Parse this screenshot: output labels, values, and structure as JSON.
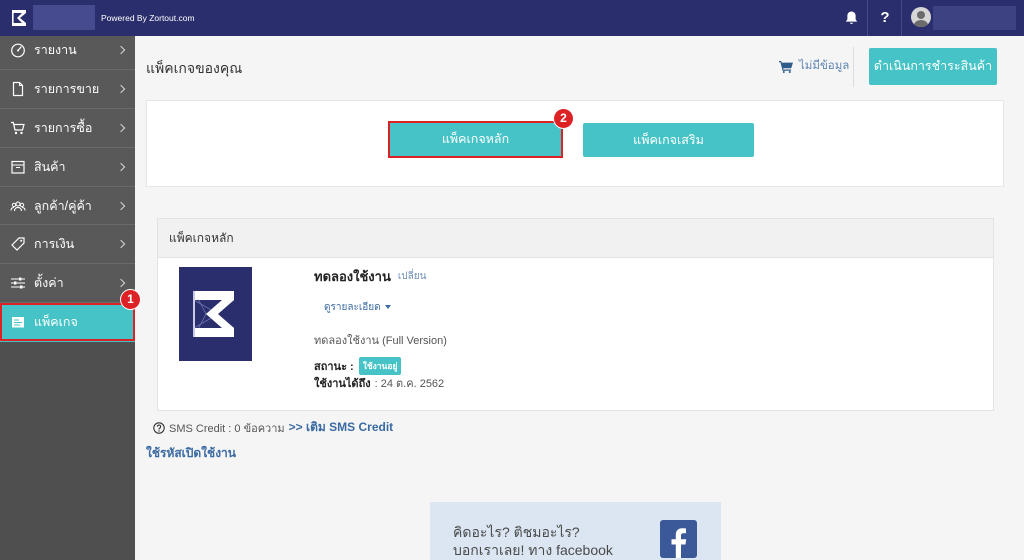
{
  "topbar": {
    "powered_by": "Powered By Zortout.com",
    "help_label": "?",
    "icons": {
      "logo": "zortout-logo-icon",
      "notifications": "bell-icon",
      "user": "avatar-icon"
    }
  },
  "sidebar": {
    "items": [
      {
        "label": "รายงาน",
        "icon": "speedometer-icon",
        "has_submenu": true
      },
      {
        "label": "รายการขาย",
        "icon": "document-icon",
        "has_submenu": true
      },
      {
        "label": "รายการซื้อ",
        "icon": "cart-icon",
        "has_submenu": true
      },
      {
        "label": "สินค้า",
        "icon": "box-icon",
        "has_submenu": true
      },
      {
        "label": "ลูกค้า/คู่ค้า",
        "icon": "people-icon",
        "has_submenu": true
      },
      {
        "label": "การเงิน",
        "icon": "tag-icon",
        "has_submenu": true
      },
      {
        "label": "ตั้งค่า",
        "icon": "sliders-icon",
        "has_submenu": true
      },
      {
        "label": "แพ็คเกจ",
        "icon": "package-icon",
        "has_submenu": false,
        "active": true
      }
    ]
  },
  "header": {
    "title": "แพ็คเกจของคุณ",
    "cart_text": "ไม่มีข้อมูล",
    "checkout_label": "ดำเนินการชำระสินค้า"
  },
  "package_tabs": {
    "main_label": "แพ็คเกจหลัก",
    "addon_label": "แพ็คเกจเสริม"
  },
  "step_badges": [
    "1",
    "2"
  ],
  "package_panel": {
    "heading": "แพ็คเกจหลัก",
    "plan_name": "ทดลองใช้งาน",
    "change_link": "เปลี่ยน",
    "details_link": "ดูรายละเอียด",
    "plan_description": "ทดลองใช้งาน (Full Version)",
    "status_label": "สถานะ :",
    "status_badge": "ใช้งานอยู่",
    "expiry_label": "ใช้งานได้ถึง",
    "expiry_value": ": 24 ต.ค. 2562"
  },
  "sms": {
    "credit_text": "SMS Credit : 0 ข้อความ",
    "topup_link": ">> เติม SMS Credit"
  },
  "activation_link": "ใช้รหัสเปิดใช้งาน",
  "facebook_promo": {
    "line1": "คิดอะไร? ติชมอะไร?",
    "line2": "บอกเราเลย! ทาง facebook",
    "icon": "facebook-icon"
  },
  "colors": {
    "accent": "#45c3c6",
    "brand": "#2b2e6c",
    "highlight": "#dd2226",
    "link": "#3a6aa3",
    "facebook": "#3b5998"
  }
}
